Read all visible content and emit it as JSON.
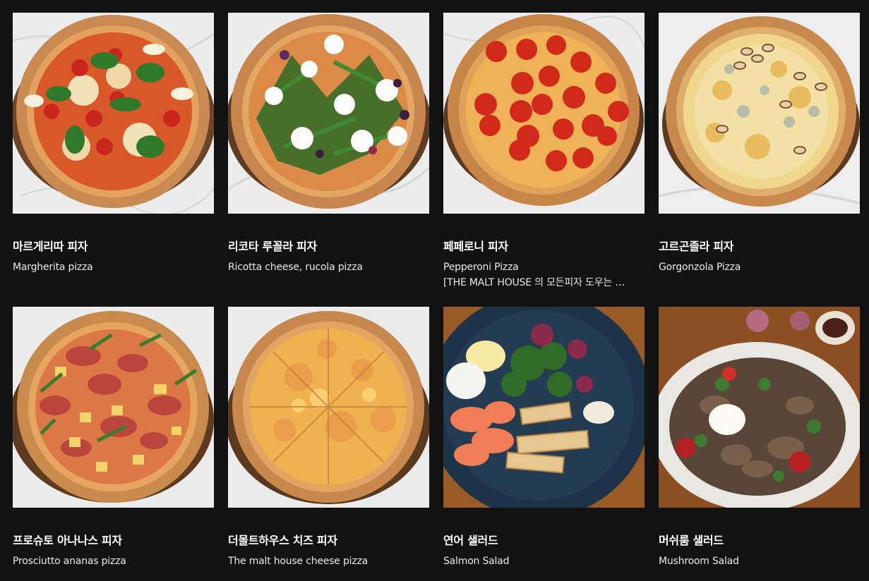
{
  "menu": {
    "items": [
      {
        "name_ko": "마르게리따 피자",
        "name_en": "Margherita pizza",
        "description": "",
        "image": "margherita-pizza-photo"
      },
      {
        "name_ko": "리코타 루꼴라 피자",
        "name_en": "Ricotta cheese, rucola pizza",
        "description": "",
        "image": "ricotta-rucola-pizza-photo"
      },
      {
        "name_ko": "페페로니 피자",
        "name_en": "Pepperoni Pizza",
        "description": "[THE MALT HOUSE 의 모든피자 도우는 …",
        "image": "pepperoni-pizza-photo"
      },
      {
        "name_ko": "고르곤졸라 피자",
        "name_en": "Gorgonzola Pizza",
        "description": "",
        "image": "gorgonzola-pizza-photo"
      },
      {
        "name_ko": "프로슈토 아나나스 피자",
        "name_en": "Prosciutto ananas pizza",
        "description": "",
        "image": "prosciutto-ananas-pizza-photo"
      },
      {
        "name_ko": "더몰트하우스 치즈 피자",
        "name_en": "The malt house cheese pizza",
        "description": "",
        "image": "cheese-pizza-photo"
      },
      {
        "name_ko": "연어 샐러드",
        "name_en": "Salmon Salad",
        "description": "",
        "image": "salmon-salad-photo"
      },
      {
        "name_ko": "머쉬룸 샐러드",
        "name_en": "Mushroom Salad",
        "description": "",
        "image": "mushroom-salad-photo"
      }
    ]
  },
  "colors": {
    "background": "#121212",
    "text_primary": "#ffffff",
    "text_secondary": "#e9e9e9"
  }
}
